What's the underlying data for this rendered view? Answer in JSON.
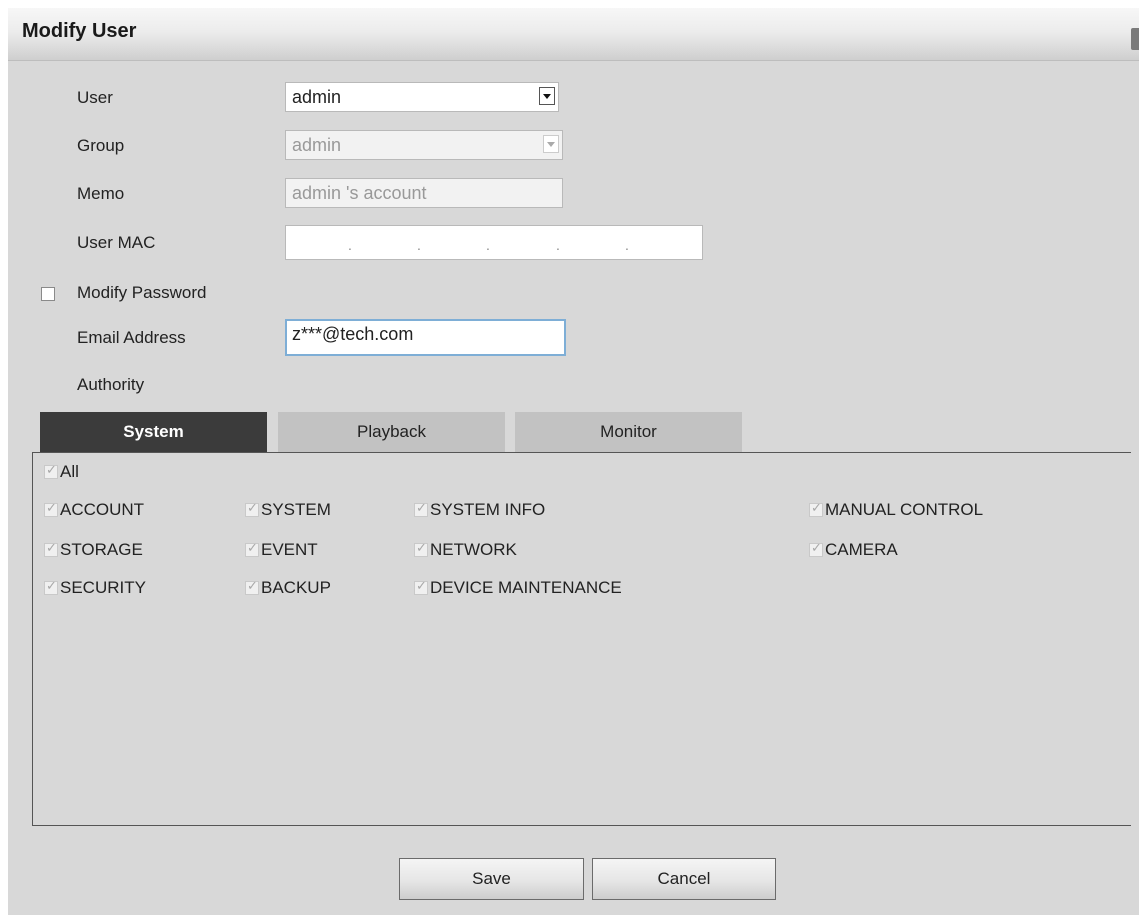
{
  "dialog": {
    "title": "Modify User"
  },
  "form": {
    "user_label": "User",
    "user_value": "admin",
    "group_label": "Group",
    "group_value": "admin",
    "memo_label": "Memo",
    "memo_value": "admin 's account",
    "mac_label": "User MAC",
    "modify_password_label": "Modify Password",
    "email_label": "Email Address",
    "email_value": "z***@tech.com",
    "authority_label": "Authority"
  },
  "tabs": [
    {
      "label": "System",
      "active": true
    },
    {
      "label": "Playback",
      "active": false
    },
    {
      "label": "Monitor",
      "active": false
    }
  ],
  "permissions": {
    "all": "All",
    "items": [
      "ACCOUNT",
      "SYSTEM",
      "SYSTEM INFO",
      "MANUAL CONTROL",
      "STORAGE",
      "EVENT",
      "NETWORK",
      "CAMERA",
      "SECURITY",
      "BACKUP",
      "DEVICE MAINTENANCE"
    ]
  },
  "buttons": {
    "save": "Save",
    "cancel": "Cancel"
  },
  "colors": {
    "active_tab": "#3b3b3b",
    "inactive_tab": "#c2c2c2",
    "background": "#d8d8d8",
    "focus_border": "#7eaed6"
  }
}
